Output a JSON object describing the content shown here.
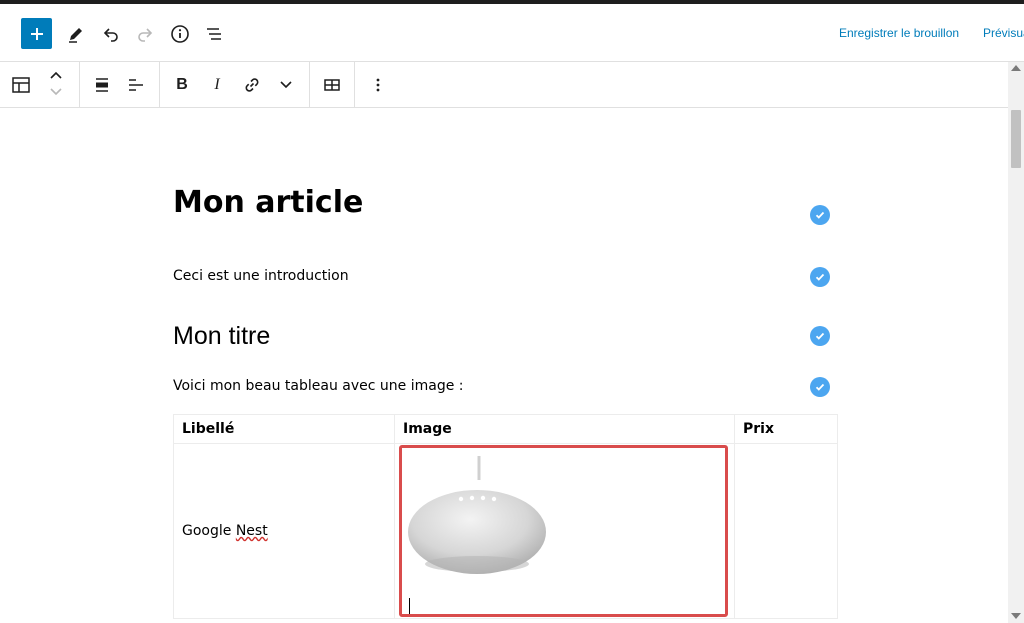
{
  "topbar": {
    "add_label": "+",
    "save_draft": "Enregistrer le brouillon",
    "preview": "Prévisualiser"
  },
  "content": {
    "title": "Mon article",
    "intro": "Ceci est une introduction",
    "heading": "Mon titre",
    "table_intro": "Voici mon beau tableau avec une image :"
  },
  "table": {
    "headers": [
      "Libellé",
      "Image",
      "Prix"
    ],
    "rows": [
      {
        "label_before": "Google ",
        "label_misspelled": "Nest",
        "price": ""
      }
    ]
  },
  "toolbar": {
    "bold_label": "B",
    "italic_label": "I"
  },
  "colors": {
    "accent": "#007cba",
    "check": "#4ca6f0",
    "selection": "#d94c4c"
  }
}
